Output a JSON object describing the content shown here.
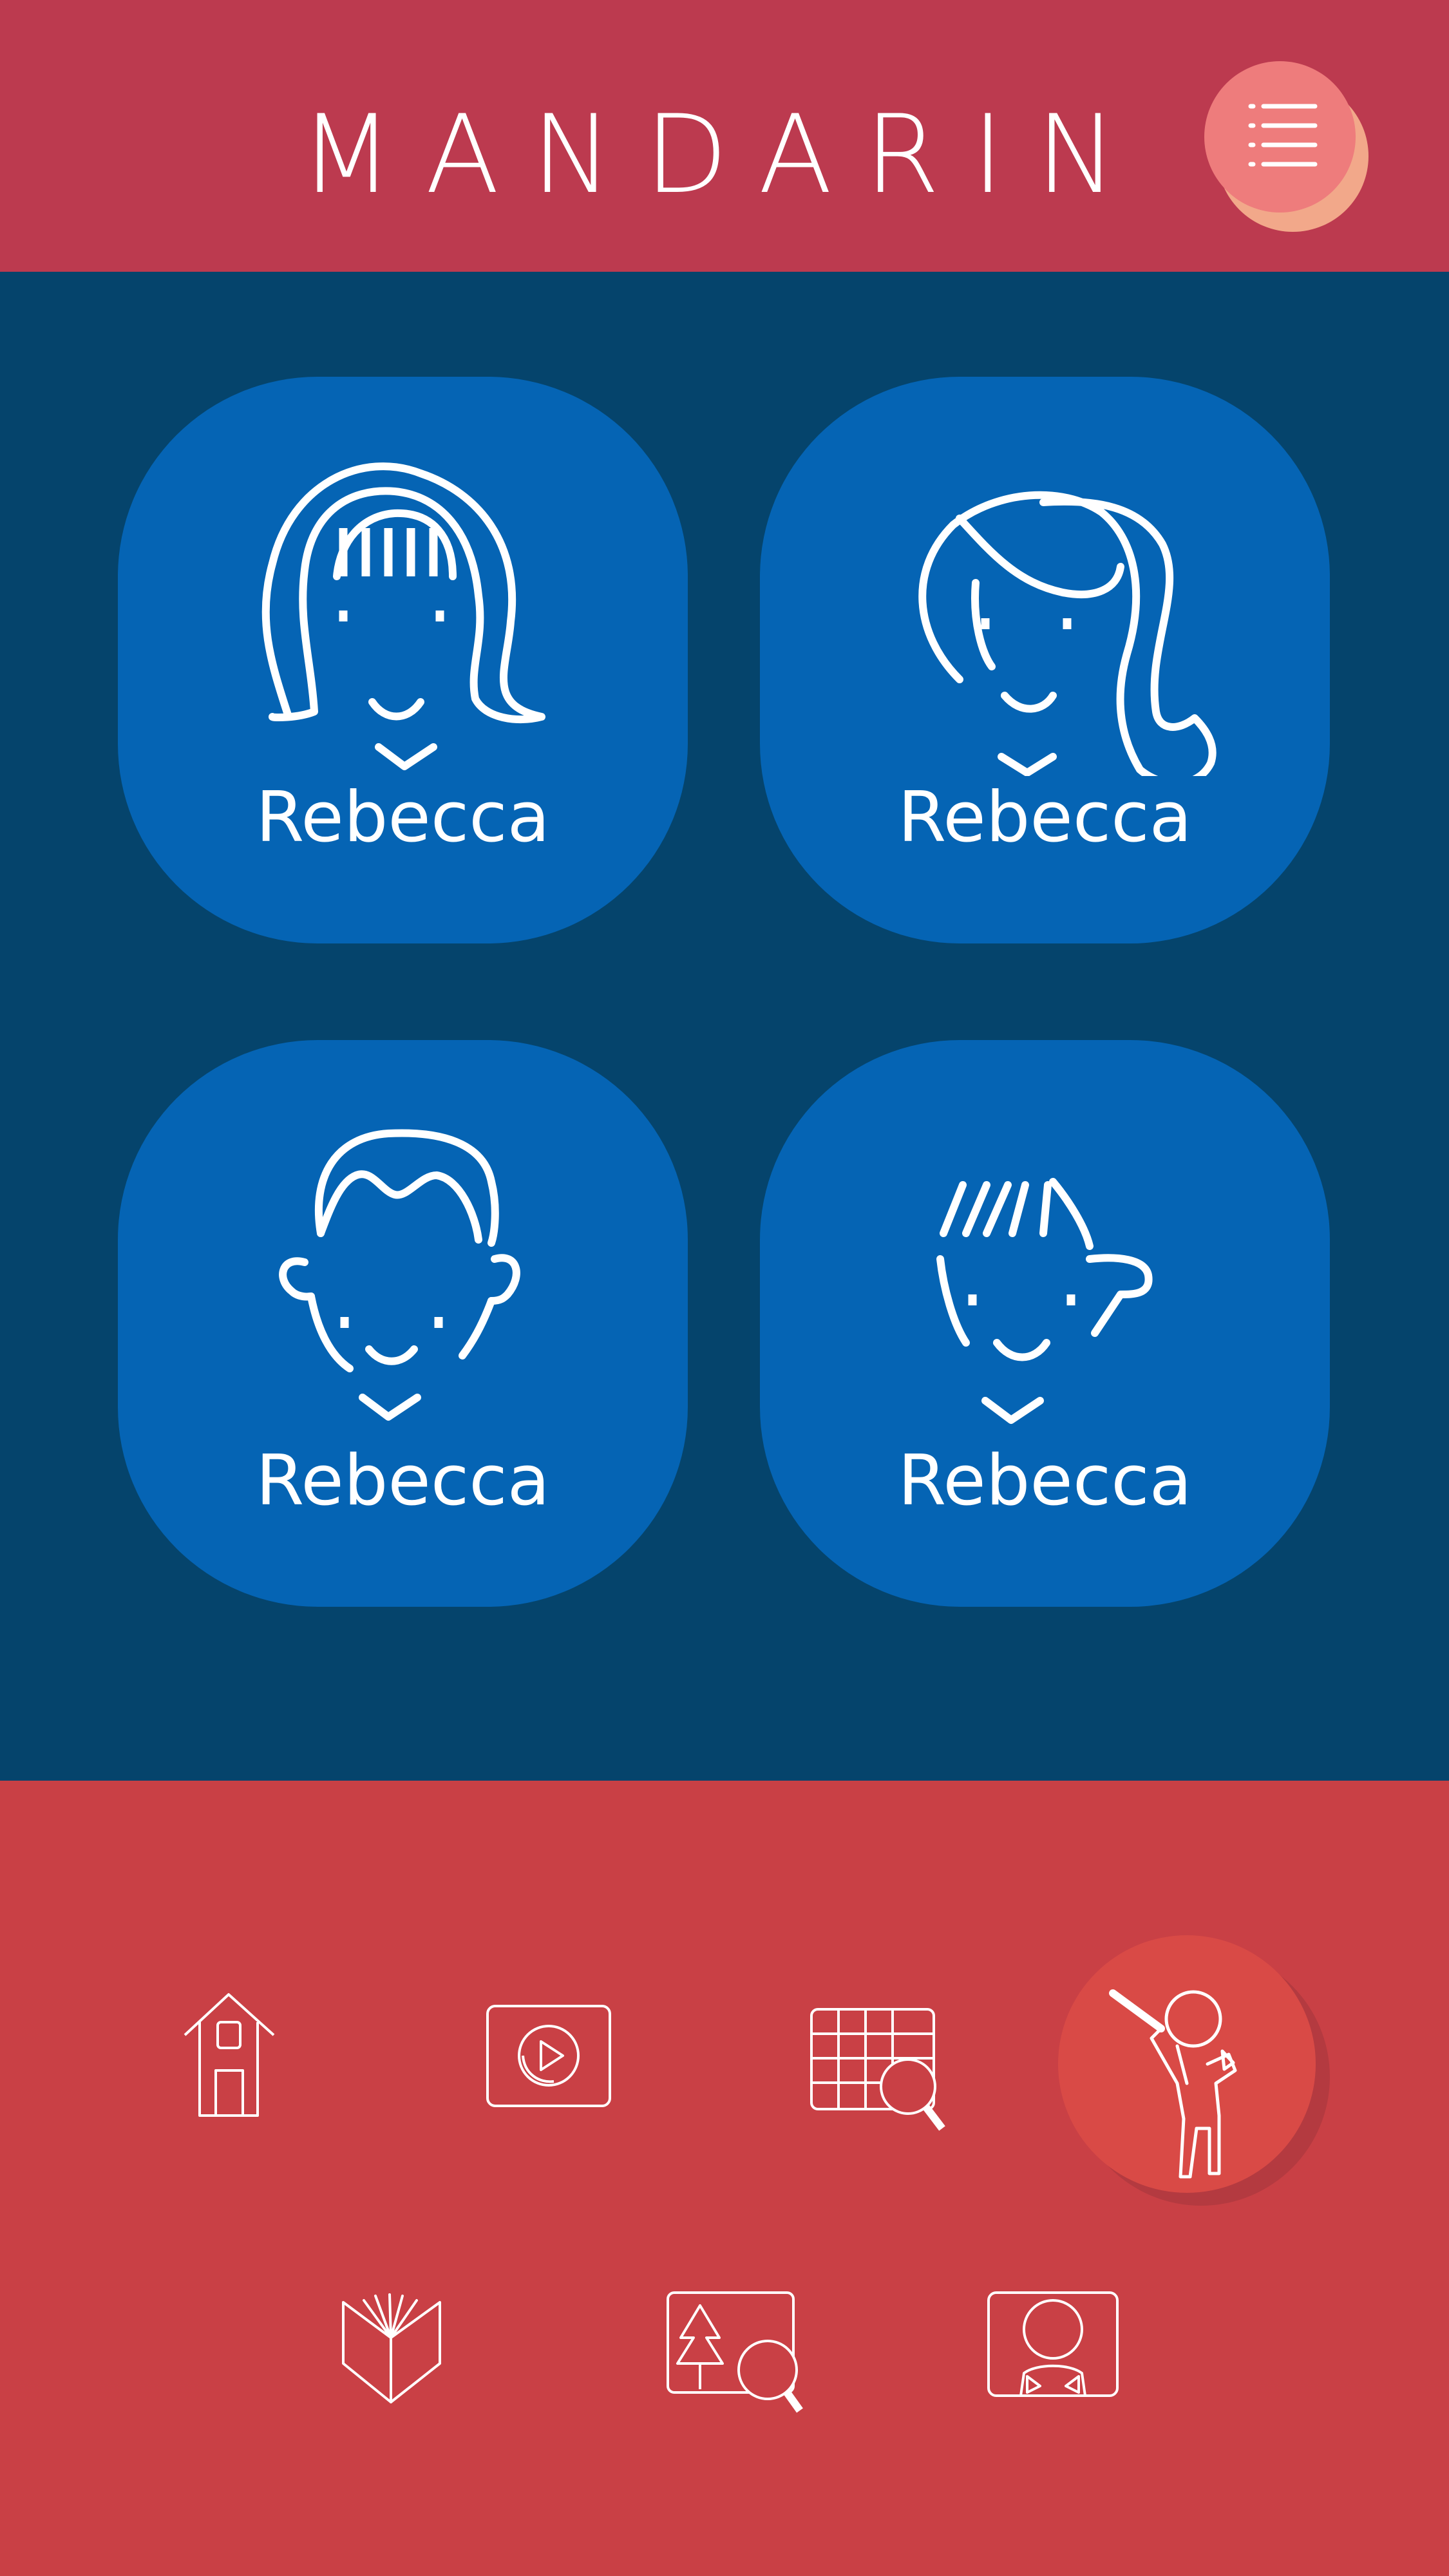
{
  "header": {
    "title": "MANDARIN",
    "menu_icon": "list-menu-icon"
  },
  "profiles": [
    {
      "name": "Rebecca",
      "icon": "girl-bangs-avatar-icon"
    },
    {
      "name": "Rebecca",
      "icon": "girl-side-hair-avatar-icon"
    },
    {
      "name": "Rebecca",
      "icon": "boy-curly-avatar-icon"
    },
    {
      "name": "Rebecca",
      "icon": "boy-spiky-avatar-icon"
    }
  ],
  "nav": {
    "items": [
      {
        "icon": "home-icon"
      },
      {
        "icon": "video-play-icon"
      },
      {
        "icon": "calendar-search-icon"
      },
      {
        "icon": "teacher-pointer-icon",
        "active": true
      },
      {
        "icon": "open-book-icon"
      },
      {
        "icon": "picture-search-icon"
      },
      {
        "icon": "profile-card-icon"
      }
    ]
  },
  "colors": {
    "header": "#bc3a4f",
    "main": "#05446c",
    "card": "#0564b4",
    "bottom": "#c94045",
    "active": "#d94a46",
    "menu_button": "#ee7c7c"
  }
}
